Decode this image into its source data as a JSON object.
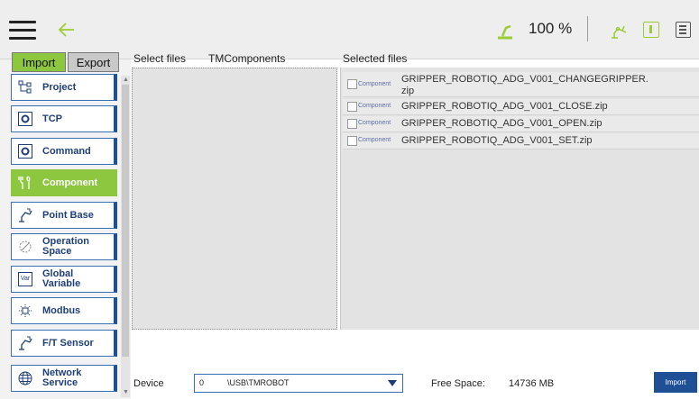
{
  "topbar": {
    "speed": "100 %",
    "accent_color": "#8dc63f"
  },
  "sidebar": {
    "tabs": [
      "Import",
      "Export"
    ],
    "items": [
      {
        "label": "Project",
        "icon": "project-tree-icon"
      },
      {
        "label": "TCP",
        "icon": "tcp-gear-icon"
      },
      {
        "label": "Command",
        "icon": "command-gear-icon"
      },
      {
        "label": "Component",
        "icon": "component-tools-icon",
        "active": true
      },
      {
        "label": "Point Base",
        "icon": "point-base-icon"
      },
      {
        "label": "Operation",
        "label2": "Space",
        "icon": "operation-space-icon"
      },
      {
        "label": "Global Variable",
        "icon": "var-icon",
        "icon_text": "Var"
      },
      {
        "label": "Modbus",
        "icon": "modbus-icon"
      },
      {
        "label": "F/T Sensor",
        "icon": "ft-sensor-icon"
      },
      {
        "label": "Network Service",
        "icon": "globe-icon"
      }
    ]
  },
  "files": {
    "title": "Select files",
    "source": "TMComponents"
  },
  "selected": {
    "title": "Selected files",
    "rows": [
      {
        "type": "Component",
        "name": "GRIPPER_ROBOTIQ_ADG_V001_CHANGEGRIPPER.",
        "name2": "zip"
      },
      {
        "type": "Component",
        "name": "GRIPPER_ROBOTIQ_ADG_V001_CLOSE.zip"
      },
      {
        "type": "Component",
        "name": "GRIPPER_ROBOTIQ_ADG_V001_OPEN.zip"
      },
      {
        "type": "Component",
        "name": "GRIPPER_ROBOTIQ_ADG_V001_SET.zip"
      }
    ]
  },
  "bottom": {
    "device_label": "Device",
    "device_index": "0",
    "device_path": "\\USB\\TMROBOT",
    "free_label": "Free Space:",
    "free_value": "14736 MB",
    "import_label": "Import"
  }
}
